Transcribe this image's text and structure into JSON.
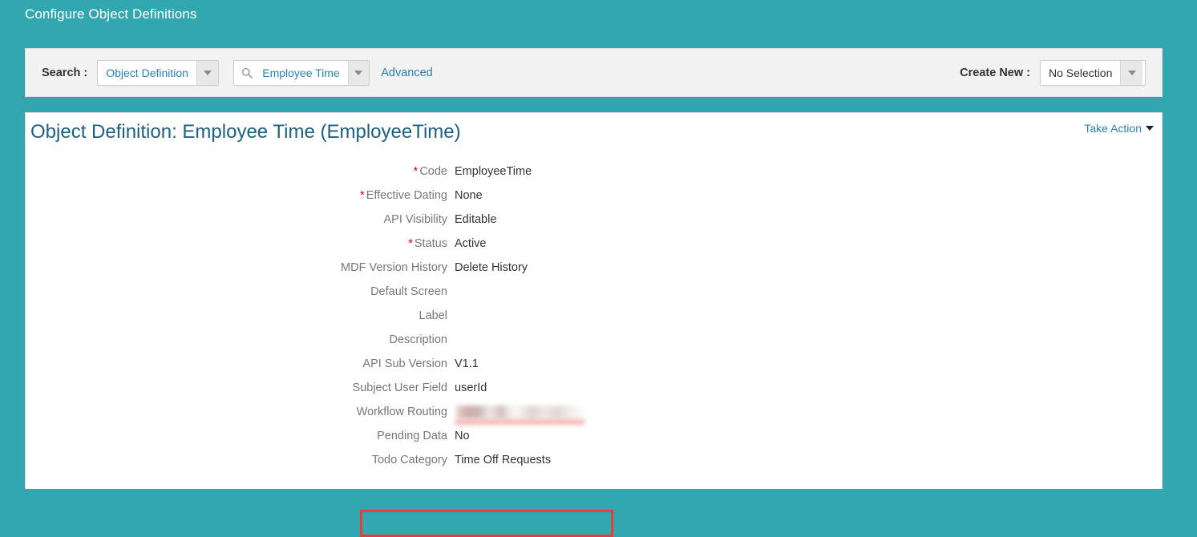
{
  "page": {
    "title": "Configure Object Definitions",
    "accent_teal": "#33a7af",
    "link_blue": "#2a7fb5",
    "required_red": "#d0021b",
    "highlight_red": "#ef3b36"
  },
  "search_bar": {
    "search_label": "Search :",
    "object_type_select": {
      "value": "Object Definition",
      "icon": "chevron-down-icon"
    },
    "search_input": {
      "value": "Employee Time",
      "placeholder": "Employee Time",
      "icon": "search-icon",
      "dropdown_icon": "chevron-down-icon"
    },
    "advanced_link": "Advanced",
    "create_new_label": "Create New :",
    "create_new_select": {
      "value": "No Selection",
      "icon": "chevron-down-icon"
    }
  },
  "detail": {
    "title": "Object Definition: Employee Time (EmployeeTime)",
    "take_action": {
      "label": "Take Action",
      "icon": "caret-down-icon"
    },
    "fields": [
      {
        "label": "Code",
        "value": "EmployeeTime",
        "required": true,
        "redacted": false
      },
      {
        "label": "Effective Dating",
        "value": "None",
        "required": true,
        "redacted": false
      },
      {
        "label": "API Visibility",
        "value": "Editable",
        "required": false,
        "redacted": false
      },
      {
        "label": "Status",
        "value": "Active",
        "required": true,
        "redacted": false
      },
      {
        "label": "MDF Version History",
        "value": "Delete History",
        "required": false,
        "redacted": false
      },
      {
        "label": "Default Screen",
        "value": "",
        "required": false,
        "redacted": false
      },
      {
        "label": "Label",
        "value": "",
        "required": false,
        "redacted": false
      },
      {
        "label": "Description",
        "value": "",
        "required": false,
        "redacted": false
      },
      {
        "label": "API Sub Version",
        "value": "V1.1",
        "required": false,
        "redacted": false
      },
      {
        "label": "Subject User Field",
        "value": "userId",
        "required": false,
        "redacted": false
      },
      {
        "label": "Workflow Routing",
        "value": "",
        "required": false,
        "redacted": true
      },
      {
        "label": "Pending Data",
        "value": "No",
        "required": false,
        "redacted": false
      },
      {
        "label": "Todo Category",
        "value": "Time Off Requests",
        "required": false,
        "redacted": false
      }
    ]
  }
}
